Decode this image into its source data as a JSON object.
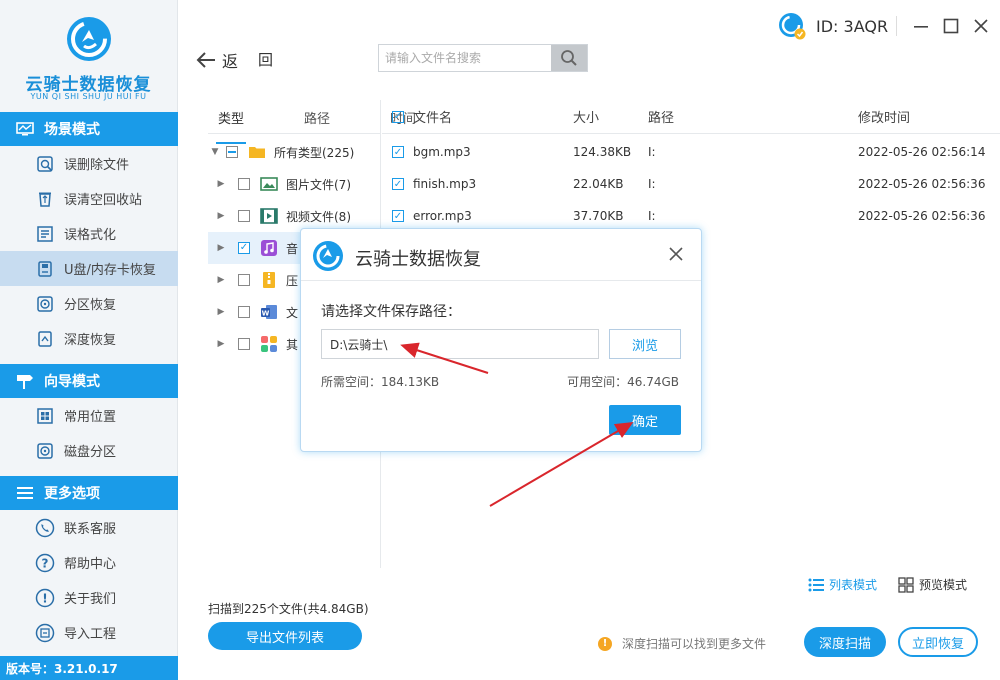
{
  "app": {
    "name": "云骑士数据恢复",
    "pinyin": "YUN QI SHI SHU JU HUI FU",
    "user_id": "ID: 3AQR",
    "version": "版本号：3.21.0.17"
  },
  "sidebar": {
    "sections": [
      {
        "title": "场景模式",
        "items": [
          {
            "label": "误删除文件",
            "icon": "file-delete-icon"
          },
          {
            "label": "误清空回收站",
            "icon": "recycle-bin-icon"
          },
          {
            "label": "误格式化",
            "icon": "format-icon"
          },
          {
            "label": "U盘/内存卡恢复",
            "icon": "usb-card-icon",
            "active": true
          },
          {
            "label": "分区恢复",
            "icon": "partition-icon"
          },
          {
            "label": "深度恢复",
            "icon": "deep-recover-icon"
          }
        ]
      },
      {
        "title": "向导模式",
        "items": [
          {
            "label": "常用位置",
            "icon": "windows-icon"
          },
          {
            "label": "磁盘分区",
            "icon": "disk-icon"
          }
        ]
      },
      {
        "title": "更多选项",
        "items": [
          {
            "label": "联系客服",
            "icon": "phone-icon"
          },
          {
            "label": "帮助中心",
            "icon": "help-icon"
          },
          {
            "label": "关于我们",
            "icon": "info-icon"
          },
          {
            "label": "导入工程",
            "icon": "import-icon"
          }
        ]
      }
    ]
  },
  "toolbar": {
    "back_label": "返",
    "back_label2": "回",
    "search_placeholder": "请输入文件名搜索"
  },
  "tree": {
    "tabs": [
      "类型",
      "路径",
      "时间"
    ],
    "rows": [
      {
        "label": "所有类型(225)",
        "state": "partial",
        "expanded": true,
        "icon": "folder-icon"
      },
      {
        "label": "图片文件(7)",
        "state": "unchecked",
        "icon": "image-file-icon"
      },
      {
        "label": "视频文件(8)",
        "state": "unchecked",
        "icon": "video-file-icon"
      },
      {
        "label": "音",
        "state": "checked",
        "icon": "audio-file-icon",
        "selected": true
      },
      {
        "label": "压",
        "state": "unchecked",
        "icon": "archive-file-icon"
      },
      {
        "label": "文",
        "state": "unchecked",
        "icon": "document-file-icon"
      },
      {
        "label": "其",
        "state": "unchecked",
        "icon": "other-file-icon"
      }
    ]
  },
  "list": {
    "columns": [
      "文件名",
      "大小",
      "路径",
      "修改时间"
    ],
    "rows": [
      {
        "name": "bgm.mp3",
        "size": "124.38KB",
        "path": "I:",
        "modified": "2022-05-26 02:56:14"
      },
      {
        "name": "finish.mp3",
        "size": "22.04KB",
        "path": "I:",
        "modified": "2022-05-26 02:56:36"
      },
      {
        "name": "error.mp3",
        "size": "37.70KB",
        "path": "I:",
        "modified": "2022-05-26 02:56:36"
      }
    ]
  },
  "bottom": {
    "scan_info": "扫描到225个文件(共4.84GB)",
    "export_label": "导出文件列表",
    "view_list": "列表模式",
    "view_preview": "预览模式",
    "tip": "深度扫描可以找到更多文件",
    "deep_scan": "深度扫描",
    "recover_now": "立即恢复"
  },
  "dialog": {
    "title": "云骑士数据恢复",
    "prompt": "请选择文件保存路径：",
    "path_value": "D:\\云骑士\\",
    "browse": "浏览",
    "need_space": "所需空间：184.13KB",
    "avail_space": "可用空间：46.74GB",
    "ok": "确定"
  },
  "colors": {
    "accent": "#1a9be8",
    "annotation": "#d9262c"
  }
}
